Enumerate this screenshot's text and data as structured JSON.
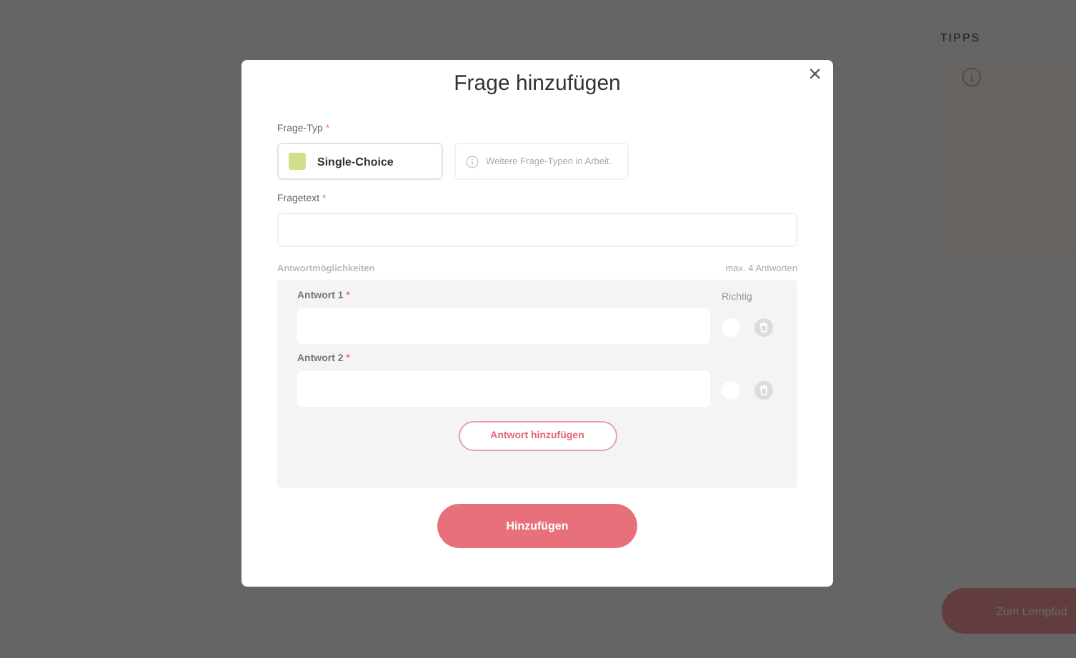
{
  "background": {
    "tips": {
      "heading": "TIPPS"
    },
    "next_button": "Zum Lernpfad"
  },
  "dialog": {
    "title": "Frage hinzufügen",
    "close": "×",
    "type_label": "Frage-Typ",
    "required_mark": "*",
    "types": [
      {
        "label": "Single-Choice",
        "color": "#cfe08c",
        "selected": true
      }
    ],
    "more_types": "Weitere Frage-Typen in Arbeit.",
    "text_label": "Fragetext",
    "answers_label": "Antwortmöglichkeiten",
    "answers_hint": "max. 4 Antworten",
    "correct_label": "Richtig",
    "answers": [
      {
        "label": "Antwort 1",
        "correct": false
      },
      {
        "label": "Antwort 2",
        "correct": false
      }
    ],
    "add_answer": "Antwort hinzufügen",
    "submit": "Hinzufügen"
  }
}
